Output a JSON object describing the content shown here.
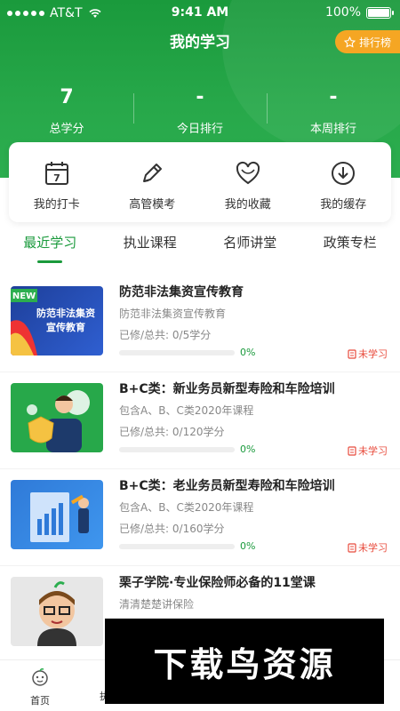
{
  "status_bar": {
    "carrier": "AT&T",
    "time": "9:41 AM",
    "battery": "100%"
  },
  "header": {
    "title": "我的学习",
    "rank_label": "排行榜"
  },
  "stats": [
    {
      "value": "7",
      "label": "总学分"
    },
    {
      "value": "-",
      "label": "今日排行"
    },
    {
      "value": "-",
      "label": "本周排行"
    }
  ],
  "quick_actions": [
    {
      "label": "我的打卡",
      "icon": "calendar-icon",
      "badge": "7"
    },
    {
      "label": "高管模考",
      "icon": "pencil-icon"
    },
    {
      "label": "我的收藏",
      "icon": "heart-icon"
    },
    {
      "label": "我的缓存",
      "icon": "download-icon"
    }
  ],
  "tabs": [
    {
      "label": "最近学习",
      "active": true
    },
    {
      "label": "执业课程"
    },
    {
      "label": "名师讲堂"
    },
    {
      "label": "政策专栏"
    }
  ],
  "courses": [
    {
      "title": "防范非法集资宣传教育",
      "subtitle": "防范非法集资宣传教育",
      "progress_text": "已修/总共: 0/5学分",
      "percent": "0%",
      "status": "未学习",
      "thumb_badge": "NEW",
      "thumb_text_1": "防范非法集资",
      "thumb_text_2": "宣传教育"
    },
    {
      "title": "B+C类：新业务员新型寿险和车险培训",
      "subtitle": "包含A、B、C类2020年课程",
      "progress_text": "已修/总共: 0/120学分",
      "percent": "0%",
      "status": "未学习"
    },
    {
      "title": "B+C类：老业务员新型寿险和车险培训",
      "subtitle": "包含A、B、C类2020年课程",
      "progress_text": "已修/总共: 0/160学分",
      "percent": "0%",
      "status": "未学习"
    },
    {
      "title": "栗子学院·专业保险师必备的11堂课",
      "subtitle": "清清楚楚讲保险"
    }
  ],
  "bottom_nav": {
    "home_label": "首页",
    "second_label": "执"
  },
  "watermark": "下载鸟资源",
  "colors": {
    "primary": "#1a9a3c",
    "accent": "#f5a623",
    "status_red": "#e84b3c"
  }
}
